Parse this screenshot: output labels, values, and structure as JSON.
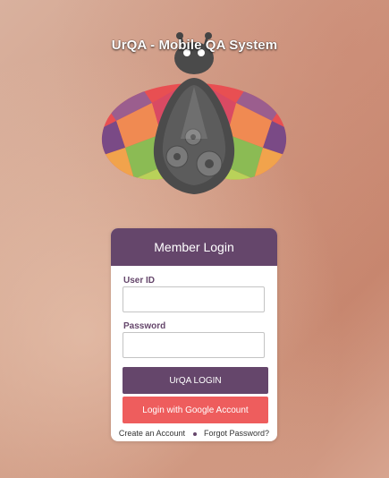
{
  "app": {
    "title": "UrQA - Mobile QA System"
  },
  "login_card": {
    "title": "Member Login",
    "user_id_label": "User ID",
    "user_id_value": "",
    "password_label": "Password",
    "password_value": "",
    "login_button": "UrQA LOGIN",
    "google_button": "Login with Google Account",
    "create_account_link": "Create an Account",
    "forgot_password_link": "Forgot Password?"
  },
  "colors": {
    "primary": "#65466b",
    "google": "#ee5d5d",
    "background": "#d4a18c"
  },
  "logo": {
    "icon": "ladybug-robot-icon"
  }
}
